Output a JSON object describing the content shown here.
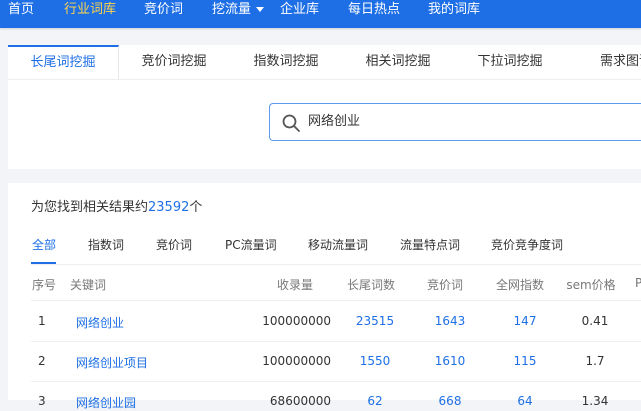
{
  "nav": {
    "items": [
      {
        "label": "首页"
      },
      {
        "label": "行业词库"
      },
      {
        "label": "竞价词"
      },
      {
        "label": "挖流量"
      },
      {
        "label": "企业库"
      },
      {
        "label": "每日热点"
      },
      {
        "label": "我的词库"
      }
    ],
    "active_index": 1
  },
  "tool_tabs": [
    {
      "label": "长尾词挖掘"
    },
    {
      "label": "竞价词挖掘"
    },
    {
      "label": "指数词挖掘"
    },
    {
      "label": "相关词挖掘"
    },
    {
      "label": "下拉词挖掘"
    },
    {
      "label": "需求图谱"
    }
  ],
  "search": {
    "value": "网络创业"
  },
  "results": {
    "prefix": "为您找到相关结果约",
    "count": "23592",
    "suffix": "个"
  },
  "filter_tabs": [
    {
      "label": "全部"
    },
    {
      "label": "指数词"
    },
    {
      "label": "竞价词"
    },
    {
      "label": "PC流量词"
    },
    {
      "label": "移动流量词"
    },
    {
      "label": "流量特点词"
    },
    {
      "label": "竞价竞争度词"
    }
  ],
  "table": {
    "headers": [
      "序号",
      "关键词",
      "收录量",
      "长尾词数",
      "竞价词",
      "全网指数",
      "sem价格",
      "P"
    ],
    "rows": [
      [
        "1",
        "网络创业",
        "100000000",
        "23515",
        "1643",
        "147",
        "0.41"
      ],
      [
        "2",
        "网络创业项目",
        "100000000",
        "1550",
        "1610",
        "115",
        "1.7"
      ],
      [
        "3",
        "网络创业园",
        "68600000",
        "62",
        "668",
        "64",
        "1.34"
      ]
    ]
  },
  "colors": {
    "brand": "#1e6fe6",
    "nav_active": "#ffd54a",
    "page_bg": "#f2f4f7"
  }
}
